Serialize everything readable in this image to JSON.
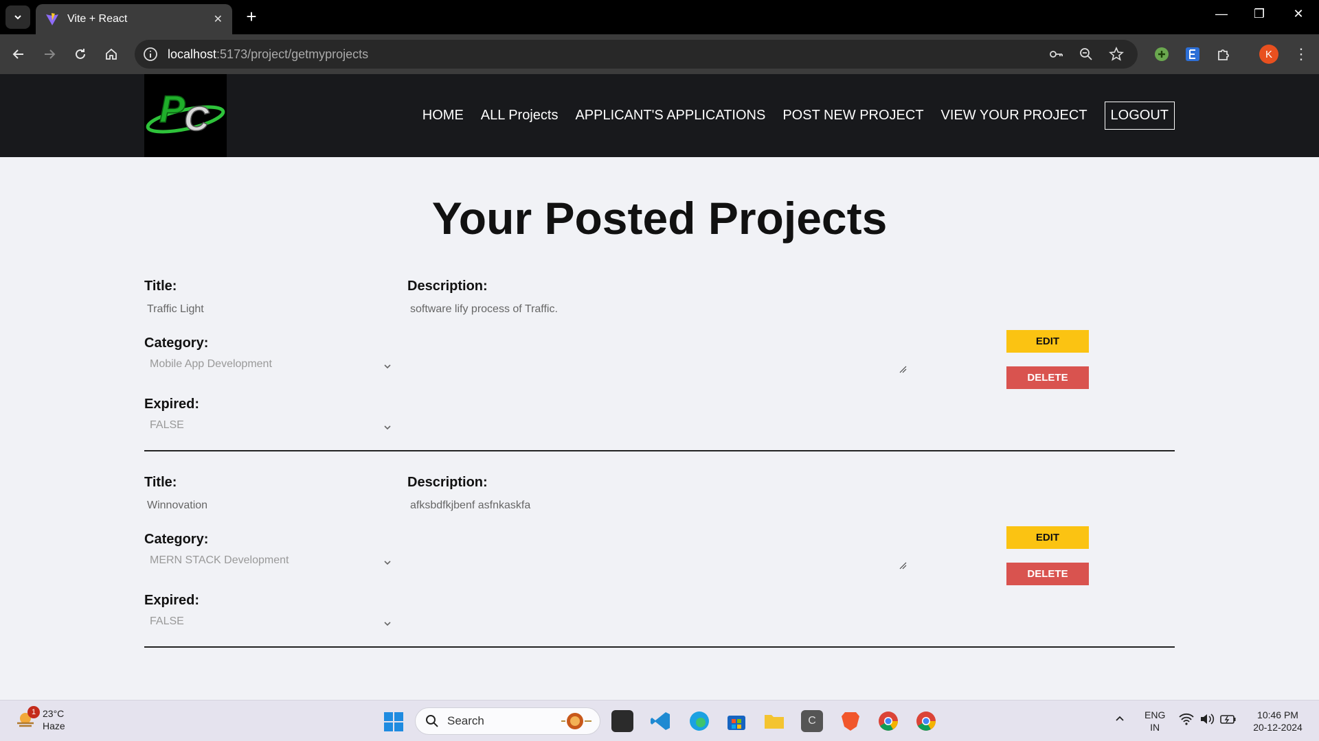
{
  "browser": {
    "tab_title": "Vite + React",
    "url_host": "localhost",
    "url_rest": ":5173/project/getmyprojects",
    "profile_initial": "K"
  },
  "site": {
    "nav": [
      "HOME",
      "ALL Projects",
      "APPLICANT'S APPLICATIONS",
      "POST NEW PROJECT",
      "VIEW YOUR PROJECT"
    ],
    "logout_label": "LOGOUT"
  },
  "page": {
    "title": "Your Posted Projects",
    "labels": {
      "title": "Title:",
      "description": "Description:",
      "category": "Category:",
      "expired": "Expired:"
    },
    "edit_label": "EDIT",
    "delete_label": "DELETE",
    "projects": [
      {
        "title": "Traffic Light",
        "description": "software  lify process of Traffic.",
        "category": "Mobile App Development",
        "expired": "FALSE"
      },
      {
        "title": "Winnovation",
        "description": "afksbdfkjbenf asfnkaskfa",
        "category": "MERN STACK Development",
        "expired": "FALSE"
      }
    ]
  },
  "taskbar": {
    "weather_badge": "1",
    "temperature": "23°C",
    "condition": "Haze",
    "search_label": "Search",
    "language": "ENG",
    "region": "IN",
    "time": "10:46 PM",
    "date": "20-12-2024"
  },
  "colors": {
    "edit": "#fbc312",
    "delete": "#d9534f",
    "header": "#18191c",
    "page_bg": "#f1f2f6"
  }
}
